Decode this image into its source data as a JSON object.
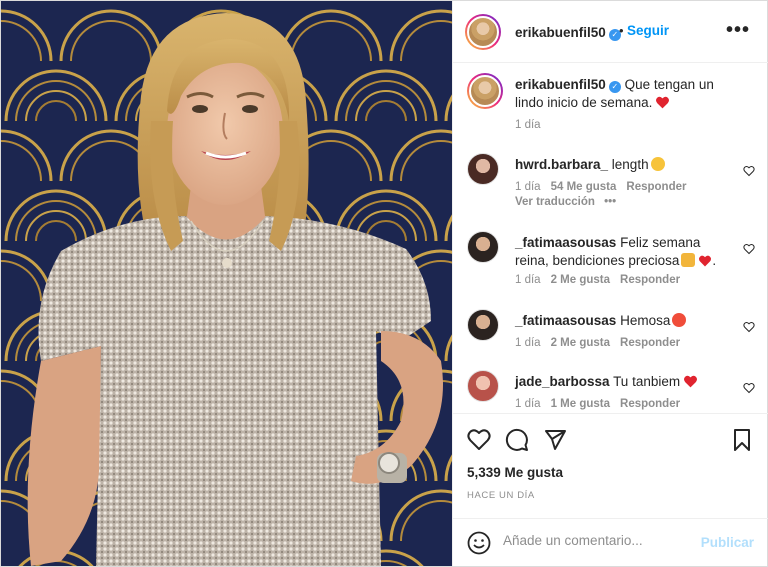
{
  "post": {
    "image_alt": "Mujer rubia sonriendo con blusa plateada de lentejuelas frente a un fondo art déco azul y dorado"
  },
  "header": {
    "username": "erikabuenfil50",
    "separator": "•",
    "follow_label": "Seguir",
    "more_icon": "ellipsis-icon"
  },
  "caption": {
    "username": "erikabuenfil50",
    "text": "Que tengan un lindo inicio de semana.",
    "time": "1 día"
  },
  "comments": [
    {
      "username": "hwrd.barbara_",
      "text": "length",
      "time": "1 día",
      "likes": "54 Me gusta",
      "reply": "Responder",
      "extra": "Ver traducción",
      "extra_dots": "•••"
    },
    {
      "username": "_fatimaasousas",
      "text": "Feliz semana reina, bendiciones preciosa",
      "time": "1 día",
      "likes": "2 Me gusta",
      "reply": "Responder"
    },
    {
      "username": "_fatimaasousas",
      "text": "Hemosa",
      "time": "1 día",
      "likes": "2 Me gusta",
      "reply": "Responder"
    },
    {
      "username": "jade_barbossa",
      "text": "Tu tanbiem",
      "time": "1 día",
      "likes": "1 Me gusta",
      "reply": "Responder"
    }
  ],
  "actions": {
    "likes": "5,339 Me gusta",
    "posted": "HACE UN DÍA"
  },
  "composer": {
    "placeholder": "Añade un comentario...",
    "publish_label": "Publicar"
  },
  "colors": {
    "accent": "#0095f6",
    "verified": "#3897f0",
    "heart": "#ed4956",
    "muted": "#8e8e8e"
  }
}
